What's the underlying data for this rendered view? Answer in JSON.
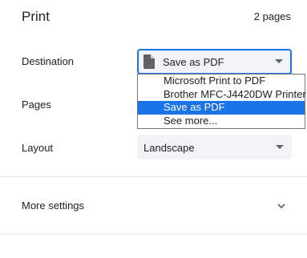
{
  "header": {
    "title": "Print",
    "page_count": "2 pages"
  },
  "destination": {
    "label": "Destination",
    "selected": "Save as PDF",
    "options": [
      "Microsoft Print to PDF",
      "Brother MFC-J4420DW Printer",
      "Save as PDF",
      "See more..."
    ]
  },
  "pages": {
    "label": "Pages"
  },
  "layout": {
    "label": "Layout",
    "selected": "Landscape"
  },
  "more_settings": {
    "label": "More settings"
  },
  "colors": {
    "accent": "#1a73e8",
    "select_bg": "#f1f3f4"
  }
}
